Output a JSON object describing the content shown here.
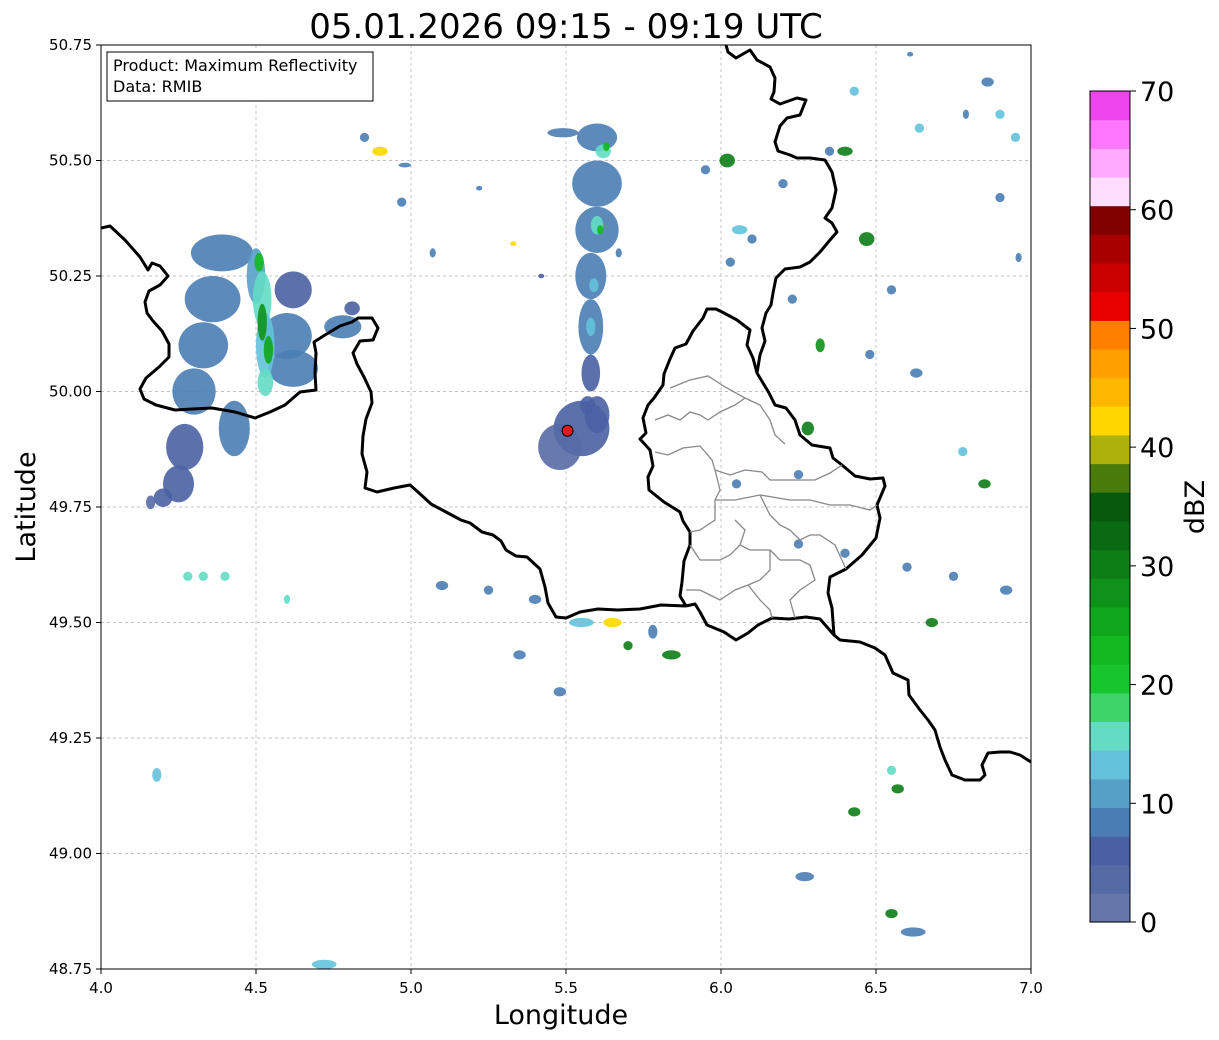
{
  "title": "05.01.2026 09:15 - 09:19 UTC",
  "info_box": {
    "product_line": "Product: Maximum Reflectivity",
    "data_line": "Data: RMIB"
  },
  "x_axis": {
    "label": "Longitude",
    "range": [
      4.0,
      7.0
    ],
    "ticks": [
      "4.0",
      "4.5",
      "5.0",
      "5.5",
      "6.0",
      "6.5",
      "7.0"
    ]
  },
  "y_axis": {
    "label": "Latitude",
    "range": [
      48.75,
      50.75
    ],
    "ticks": [
      "48.75",
      "49.00",
      "49.25",
      "49.50",
      "49.75",
      "50.00",
      "50.25",
      "50.50",
      "50.75"
    ]
  },
  "grid": true,
  "radar_site": {
    "lon": 5.505,
    "lat": 49.915,
    "color": "#e31a1c"
  },
  "colorbar": {
    "label": "dBZ",
    "range": [
      0,
      70
    ],
    "ticks": [
      "0",
      "10",
      "20",
      "30",
      "40",
      "50",
      "60",
      "70"
    ],
    "colors": [
      "#6676a8",
      "#566aa6",
      "#4a60a3",
      "#4a7db3",
      "#56a0c6",
      "#63c2da",
      "#63dbc5",
      "#3ed46a",
      "#17c62c",
      "#12b81f",
      "#10a61b",
      "#0f921a",
      "#0d7d16",
      "#0a6a13",
      "#075a0d",
      "#4a7a0a",
      "#aeb00c",
      "#ffd700",
      "#ffb700",
      "#ffa000",
      "#ff8000",
      "#e80000",
      "#c80000",
      "#a80000",
      "#800000",
      "#ffddff",
      "#ffaaff",
      "#ff77ff",
      "#ee44ee"
    ]
  },
  "colors": {
    "border": "#000000",
    "region_border": "#888888"
  },
  "echoes": [
    {
      "cells": [
        [
          4.39,
          50.3,
          0.2,
          0.08,
          3
        ],
        [
          4.36,
          50.2,
          0.18,
          0.1,
          3
        ],
        [
          4.33,
          50.1,
          0.16,
          0.1,
          3
        ],
        [
          4.3,
          50.0,
          0.14,
          0.1,
          3
        ],
        [
          4.27,
          49.88,
          0.12,
          0.1,
          2
        ],
        [
          4.25,
          49.8,
          0.1,
          0.08,
          2
        ],
        [
          4.2,
          49.77,
          0.06,
          0.04,
          2
        ],
        [
          4.16,
          49.76,
          0.03,
          0.03,
          1
        ],
        [
          4.62,
          50.22,
          0.12,
          0.08,
          2
        ],
        [
          4.6,
          50.12,
          0.16,
          0.1,
          3
        ],
        [
          4.62,
          50.05,
          0.16,
          0.08,
          3
        ],
        [
          4.43,
          49.92,
          0.1,
          0.12,
          3
        ],
        [
          4.78,
          50.14,
          0.12,
          0.05,
          3
        ],
        [
          4.81,
          50.18,
          0.05,
          0.03,
          2
        ],
        [
          4.5,
          50.25,
          0.06,
          0.12,
          4
        ],
        [
          4.52,
          50.2,
          0.06,
          0.12,
          6
        ],
        [
          4.53,
          50.1,
          0.06,
          0.14,
          5
        ],
        [
          4.52,
          50.15,
          0.03,
          0.08,
          11
        ],
        [
          4.53,
          50.02,
          0.05,
          0.06,
          6
        ],
        [
          4.51,
          50.28,
          0.03,
          0.04,
          9
        ],
        [
          4.54,
          50.09,
          0.03,
          0.06,
          10
        ]
      ]
    },
    {
      "cells": [
        [
          5.6,
          50.55,
          0.13,
          0.06,
          3
        ],
        [
          5.6,
          50.45,
          0.16,
          0.1,
          3
        ],
        [
          5.6,
          50.35,
          0.14,
          0.1,
          3
        ],
        [
          5.58,
          50.25,
          0.1,
          0.1,
          3
        ],
        [
          5.58,
          50.14,
          0.08,
          0.12,
          3
        ],
        [
          5.58,
          50.04,
          0.06,
          0.08,
          2
        ],
        [
          5.57,
          49.97,
          0.05,
          0.04,
          2
        ],
        [
          5.62,
          50.52,
          0.05,
          0.03,
          6
        ],
        [
          5.63,
          50.53,
          0.02,
          0.02,
          9
        ],
        [
          5.6,
          50.36,
          0.04,
          0.04,
          6
        ],
        [
          5.61,
          50.35,
          0.02,
          0.02,
          9
        ],
        [
          5.58,
          50.14,
          0.03,
          0.04,
          5
        ],
        [
          5.59,
          50.23,
          0.03,
          0.03,
          5
        ],
        [
          5.49,
          50.56,
          0.1,
          0.02,
          3
        ],
        [
          5.55,
          49.92,
          0.18,
          0.12,
          2
        ],
        [
          5.48,
          49.88,
          0.14,
          0.1,
          1
        ],
        [
          5.6,
          49.95,
          0.08,
          0.08,
          2
        ]
      ]
    },
    {
      "cells": [
        [
          5.22,
          50.44,
          0.02,
          0.01,
          3
        ],
        [
          5.42,
          50.25,
          0.02,
          0.01,
          2
        ],
        [
          5.33,
          50.32,
          0.02,
          0.01,
          17
        ],
        [
          4.9,
          50.52,
          0.05,
          0.02,
          17
        ],
        [
          4.98,
          50.49,
          0.04,
          0.01,
          3
        ],
        [
          5.67,
          50.3,
          0.02,
          0.02,
          3
        ],
        [
          5.95,
          50.48,
          0.03,
          0.02,
          3
        ],
        [
          6.02,
          50.5,
          0.05,
          0.03,
          12
        ],
        [
          6.06,
          50.35,
          0.05,
          0.02,
          5
        ],
        [
          6.4,
          50.52,
          0.05,
          0.02,
          12
        ],
        [
          6.47,
          50.33,
          0.05,
          0.03,
          12
        ],
        [
          6.55,
          50.22,
          0.03,
          0.02,
          3
        ],
        [
          6.23,
          50.2,
          0.03,
          0.02,
          3
        ],
        [
          6.32,
          50.1,
          0.03,
          0.03,
          11
        ],
        [
          6.03,
          50.28,
          0.03,
          0.02,
          3
        ],
        [
          6.1,
          50.33,
          0.03,
          0.02,
          3
        ],
        [
          6.28,
          49.92,
          0.04,
          0.03,
          12
        ],
        [
          6.25,
          49.82,
          0.03,
          0.02,
          3
        ],
        [
          5.55,
          49.5,
          0.08,
          0.02,
          5
        ],
        [
          5.65,
          49.5,
          0.06,
          0.02,
          17
        ],
        [
          5.7,
          49.45,
          0.03,
          0.02,
          12
        ],
        [
          5.84,
          49.43,
          0.06,
          0.02,
          12
        ],
        [
          5.78,
          49.48,
          0.03,
          0.03,
          3
        ],
        [
          6.55,
          49.18,
          0.03,
          0.02,
          6
        ],
        [
          6.57,
          49.14,
          0.04,
          0.02,
          12
        ],
        [
          6.43,
          49.09,
          0.04,
          0.02,
          12
        ],
        [
          6.55,
          48.87,
          0.04,
          0.02,
          12
        ],
        [
          6.62,
          48.83,
          0.08,
          0.02,
          3
        ],
        [
          6.27,
          48.95,
          0.06,
          0.02,
          3
        ],
        [
          4.72,
          48.76,
          0.08,
          0.02,
          5
        ],
        [
          4.18,
          49.17,
          0.03,
          0.03,
          5
        ],
        [
          4.28,
          49.6,
          0.03,
          0.02,
          6
        ],
        [
          4.33,
          49.6,
          0.03,
          0.02,
          6
        ],
        [
          4.4,
          49.6,
          0.03,
          0.02,
          6
        ],
        [
          4.6,
          49.55,
          0.02,
          0.02,
          6
        ],
        [
          5.1,
          49.58,
          0.04,
          0.02,
          3
        ],
        [
          5.25,
          49.57,
          0.03,
          0.02,
          3
        ],
        [
          5.4,
          49.55,
          0.04,
          0.02,
          3
        ],
        [
          5.35,
          49.43,
          0.04,
          0.02,
          3
        ],
        [
          5.48,
          49.35,
          0.04,
          0.02,
          3
        ],
        [
          6.9,
          50.6,
          0.03,
          0.02,
          5
        ],
        [
          6.95,
          50.55,
          0.03,
          0.02,
          5
        ],
        [
          6.92,
          49.57,
          0.04,
          0.02,
          3
        ],
        [
          6.68,
          49.5,
          0.04,
          0.02,
          12
        ],
        [
          6.6,
          49.62,
          0.03,
          0.02,
          3
        ],
        [
          6.75,
          49.6,
          0.03,
          0.02,
          3
        ],
        [
          6.85,
          49.8,
          0.04,
          0.02,
          12
        ],
        [
          6.78,
          49.87,
          0.03,
          0.02,
          5
        ],
        [
          6.63,
          50.04,
          0.04,
          0.02,
          3
        ],
        [
          6.9,
          50.42,
          0.03,
          0.02,
          3
        ],
        [
          6.48,
          50.08,
          0.03,
          0.02,
          3
        ],
        [
          6.05,
          49.8,
          0.03,
          0.02,
          3
        ],
        [
          6.25,
          49.67,
          0.03,
          0.02,
          3
        ],
        [
          6.4,
          49.65,
          0.03,
          0.02,
          3
        ],
        [
          4.85,
          50.55,
          0.03,
          0.02,
          3
        ],
        [
          4.97,
          50.41,
          0.03,
          0.02,
          3
        ],
        [
          5.07,
          50.3,
          0.02,
          0.02,
          3
        ],
        [
          6.61,
          50.73,
          0.02,
          0.01,
          3
        ],
        [
          6.86,
          50.67,
          0.04,
          0.02,
          3
        ],
        [
          6.79,
          50.6,
          0.02,
          0.02,
          3
        ],
        [
          6.43,
          50.65,
          0.03,
          0.02,
          5
        ],
        [
          6.64,
          50.57,
          0.03,
          0.02,
          5
        ],
        [
          6.96,
          50.29,
          0.02,
          0.02,
          3
        ],
        [
          6.2,
          50.45,
          0.03,
          0.02,
          3
        ],
        [
          6.35,
          50.52,
          0.03,
          0.02,
          3
        ]
      ]
    }
  ]
}
